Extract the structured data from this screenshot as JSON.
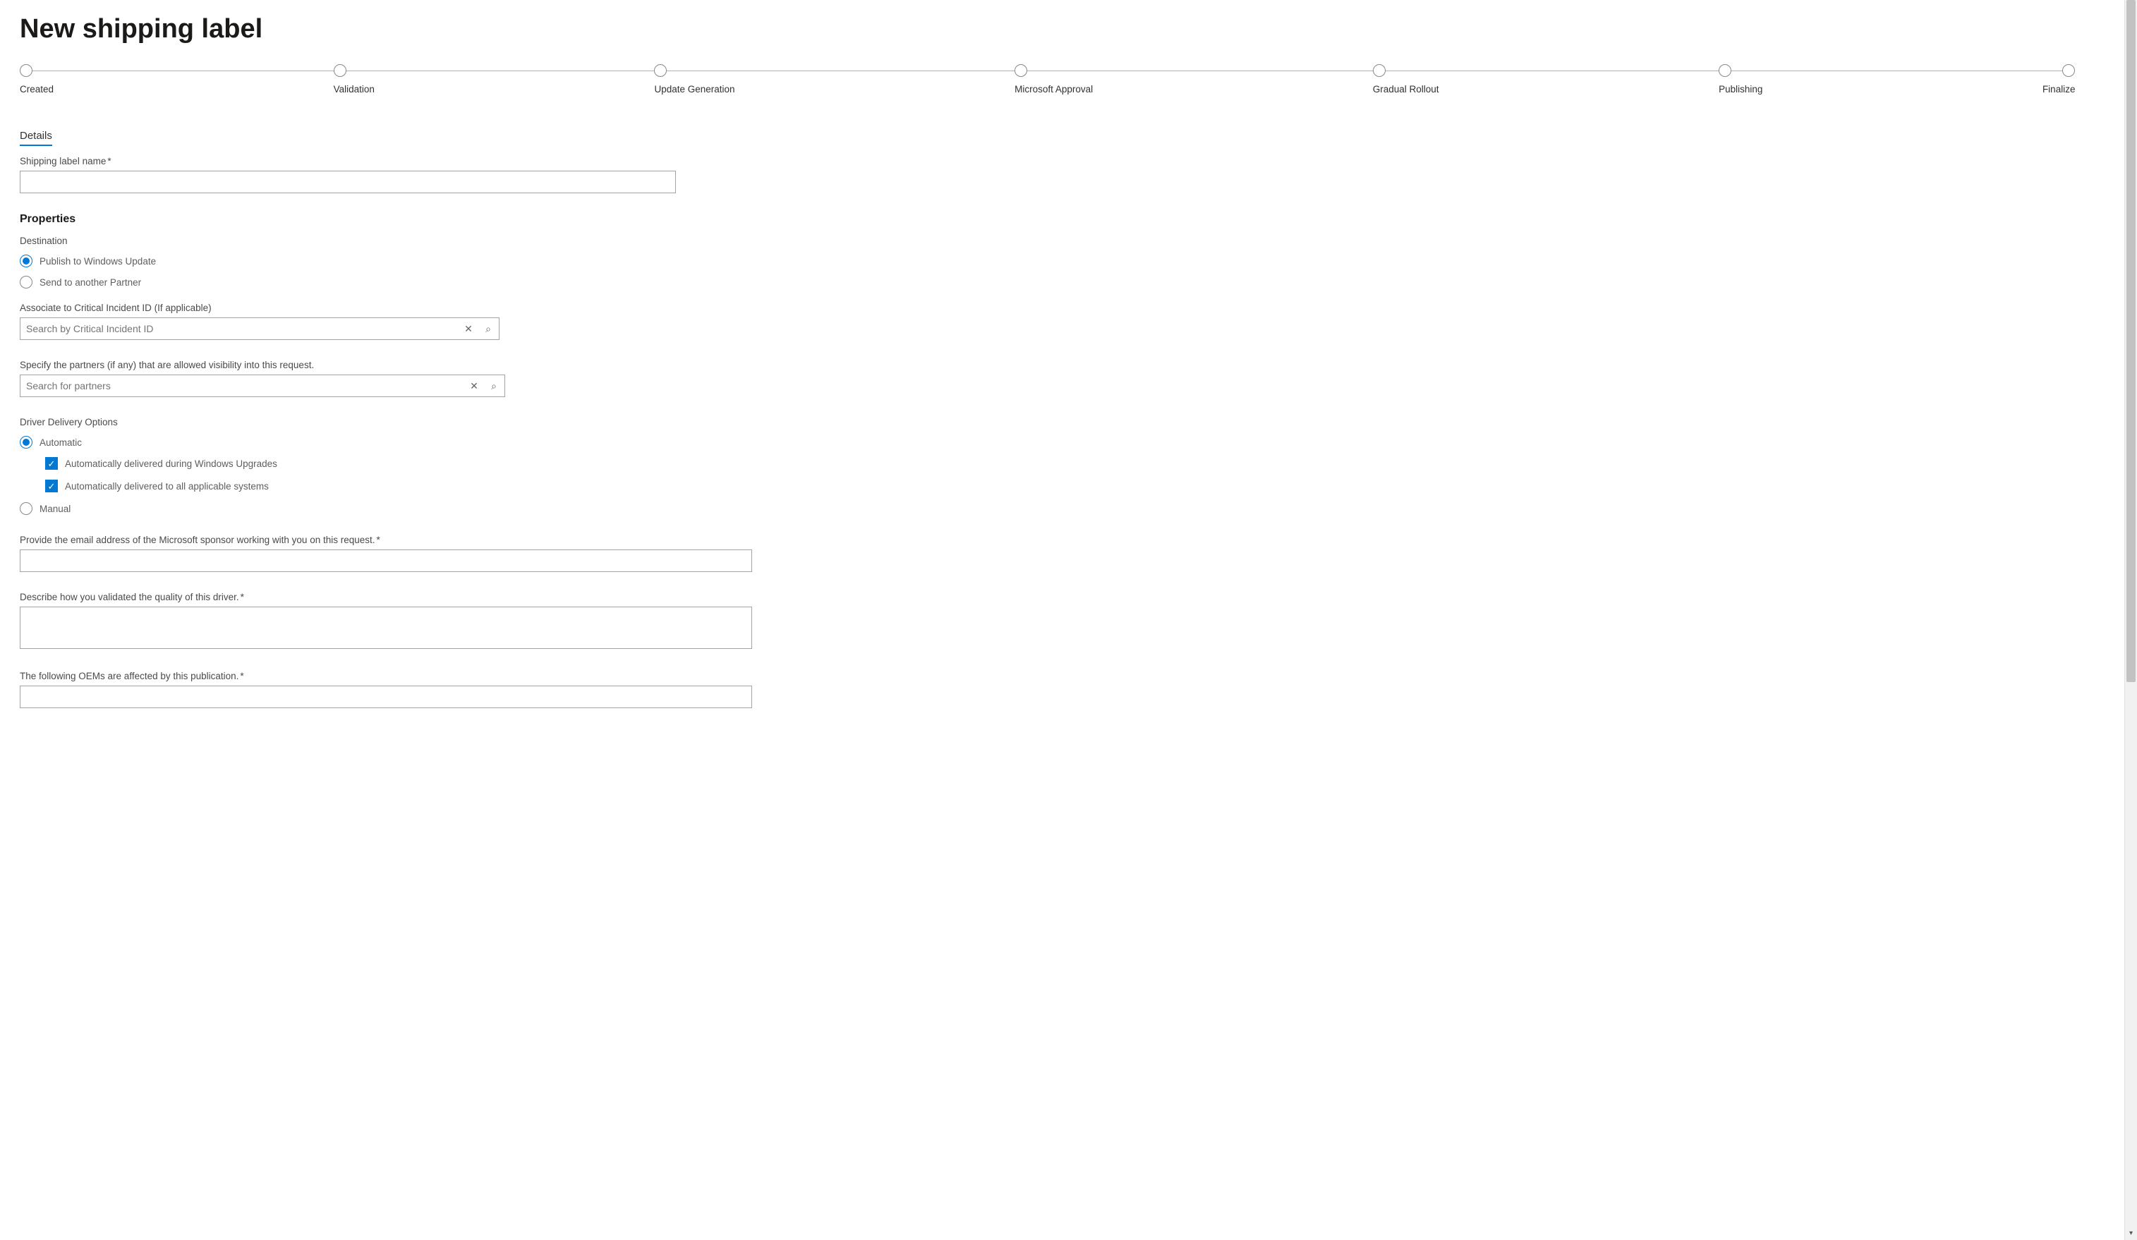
{
  "header": {
    "title": "New shipping label"
  },
  "stepper": {
    "steps": [
      {
        "label": "Created"
      },
      {
        "label": "Validation"
      },
      {
        "label": "Update Generation"
      },
      {
        "label": "Microsoft Approval"
      },
      {
        "label": "Gradual Rollout"
      },
      {
        "label": "Publishing"
      },
      {
        "label": "Finalize"
      }
    ]
  },
  "tabs": {
    "details": "Details"
  },
  "details": {
    "shipping_label_name_label": "Shipping label name",
    "shipping_label_name_value": ""
  },
  "properties": {
    "heading": "Properties",
    "destination": {
      "label": "Destination",
      "options": {
        "publish_wu": "Publish to Windows Update",
        "send_partner": "Send to another Partner"
      },
      "selected": "publish_wu"
    },
    "critical_incident": {
      "label": "Associate to Critical Incident ID (If applicable)",
      "placeholder": "Search by Critical Incident ID",
      "value": ""
    },
    "partner_visibility": {
      "label": "Specify the partners (if any) that are allowed visibility into this request.",
      "placeholder": "Search for partners",
      "value": ""
    },
    "delivery": {
      "label": "Driver Delivery Options",
      "options": {
        "automatic": "Automatic",
        "manual": "Manual"
      },
      "selected": "automatic",
      "auto_sub": {
        "upgrades": {
          "label": "Automatically delivered during Windows Upgrades",
          "checked": true
        },
        "all_systems": {
          "label": "Automatically delivered to all applicable systems",
          "checked": true
        }
      }
    },
    "sponsor_email": {
      "label": "Provide the email address of the Microsoft sponsor working with you on this request.",
      "value": ""
    },
    "validation_desc": {
      "label": "Describe how you validated the quality of this driver.",
      "value": ""
    },
    "oems_affected": {
      "label": "The following OEMs are affected by this publication.",
      "value": ""
    }
  },
  "icons": {
    "clear": "✕",
    "search": "⌕",
    "check": "✓",
    "down_arrow": "▾"
  }
}
